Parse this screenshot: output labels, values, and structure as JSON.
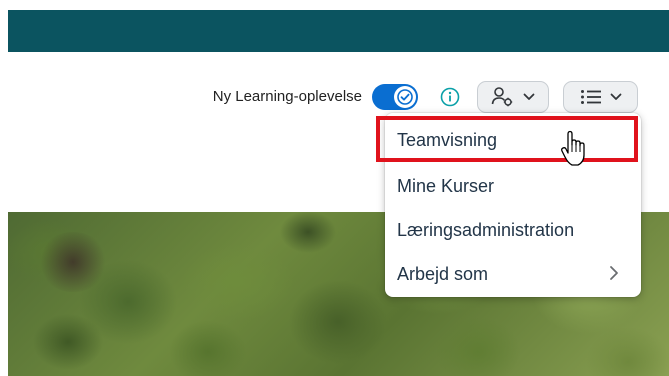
{
  "header": {
    "accent_color": "#0b5460"
  },
  "toolbar": {
    "new_experience_label": "Ny Learning-oplevelse",
    "toggle_state": "on",
    "info_icon": "info-circle-icon",
    "person_button_icon": "person-settings-icon",
    "list_button_icon": "list-icon"
  },
  "menu": {
    "items": [
      {
        "label": "Teamvisning",
        "highlighted": true
      },
      {
        "label": "Mine Kurser"
      },
      {
        "label": "Læringsadministration"
      },
      {
        "label": "Arbejd som",
        "has_submenu": true
      }
    ]
  },
  "colors": {
    "toggle": "#0a6ed1",
    "highlight_border": "#e0121c",
    "info": "#0aa0a8"
  }
}
